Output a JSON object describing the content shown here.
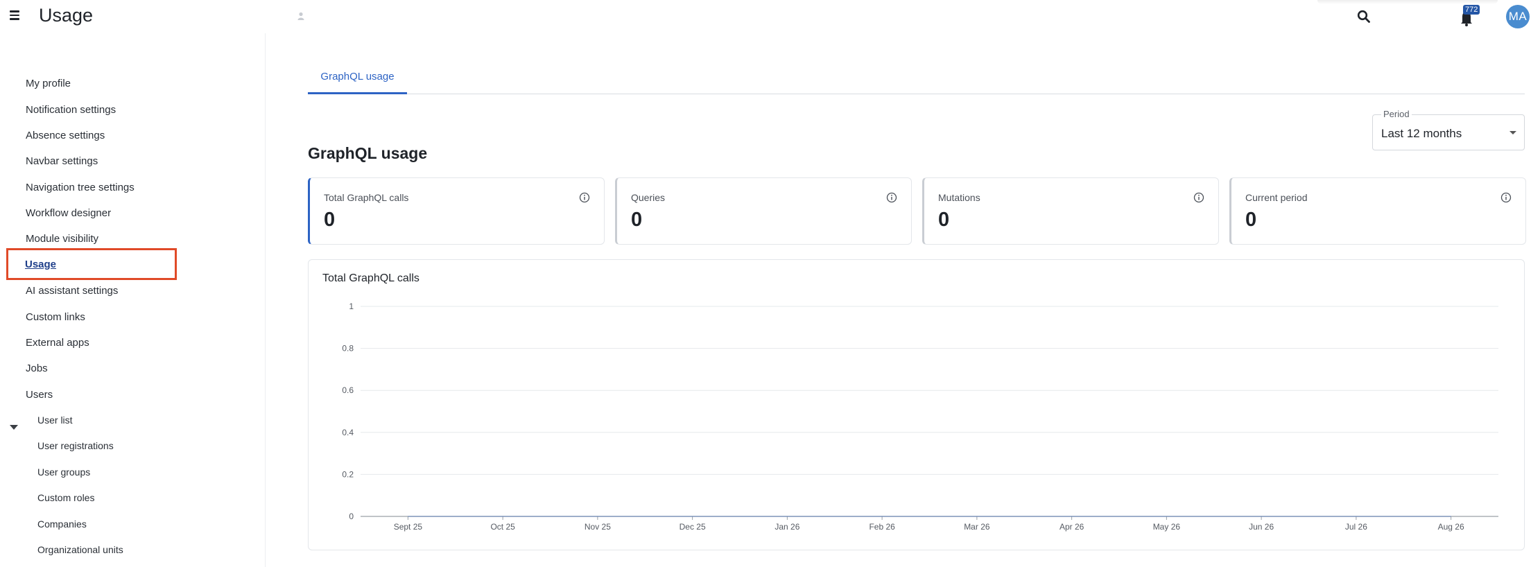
{
  "header": {
    "title": "Usage",
    "notification_count": "772",
    "avatar_initials": "MA"
  },
  "sidebar": {
    "items": [
      {
        "label": "My profile"
      },
      {
        "label": "Notification settings"
      },
      {
        "label": "Absence settings"
      },
      {
        "label": "Navbar settings"
      },
      {
        "label": "Navigation tree settings"
      },
      {
        "label": "Workflow designer"
      },
      {
        "label": "Module visibility"
      },
      {
        "label": "Usage",
        "active": true
      },
      {
        "label": "AI assistant settings"
      },
      {
        "label": "Custom links"
      },
      {
        "label": "External apps"
      },
      {
        "label": "Jobs"
      },
      {
        "label": "Users",
        "expanded": true
      }
    ],
    "sub_items": [
      {
        "label": "User list"
      },
      {
        "label": "User registrations"
      },
      {
        "label": "User groups"
      },
      {
        "label": "Custom roles"
      },
      {
        "label": "Companies"
      },
      {
        "label": "Organizational units"
      }
    ]
  },
  "main": {
    "tabs": [
      {
        "label": "GraphQL usage",
        "active": true
      }
    ],
    "period": {
      "label": "Period",
      "value": "Last 12 months"
    },
    "section_title": "GraphQL usage",
    "cards": [
      {
        "label": "Total GraphQL calls",
        "value": "0"
      },
      {
        "label": "Queries",
        "value": "0"
      },
      {
        "label": "Mutations",
        "value": "0"
      },
      {
        "label": "Current period",
        "value": "0"
      }
    ],
    "chart_title": "Total GraphQL calls"
  },
  "colors": {
    "accent": "#2d63c4",
    "highlight": "#e04a28",
    "avatar": "#4a8ccf",
    "badge": "#2456a6"
  },
  "chart_data": {
    "type": "line",
    "title": "Total GraphQL calls",
    "categories": [
      "Sept 25",
      "Oct 25",
      "Nov 25",
      "Dec 25",
      "Jan 26",
      "Feb 26",
      "Mar 26",
      "Apr 26",
      "May 26",
      "Jun 26",
      "Jul 26",
      "Aug 26"
    ],
    "values": [
      0,
      0,
      0,
      0,
      0,
      0,
      0,
      0,
      0,
      0,
      0,
      0
    ],
    "ylim": [
      0,
      1
    ],
    "yticks": [
      "0",
      "0.2",
      "0.4",
      "0.6",
      "0.8",
      "1"
    ],
    "grid": true,
    "xlabel": "",
    "ylabel": ""
  }
}
